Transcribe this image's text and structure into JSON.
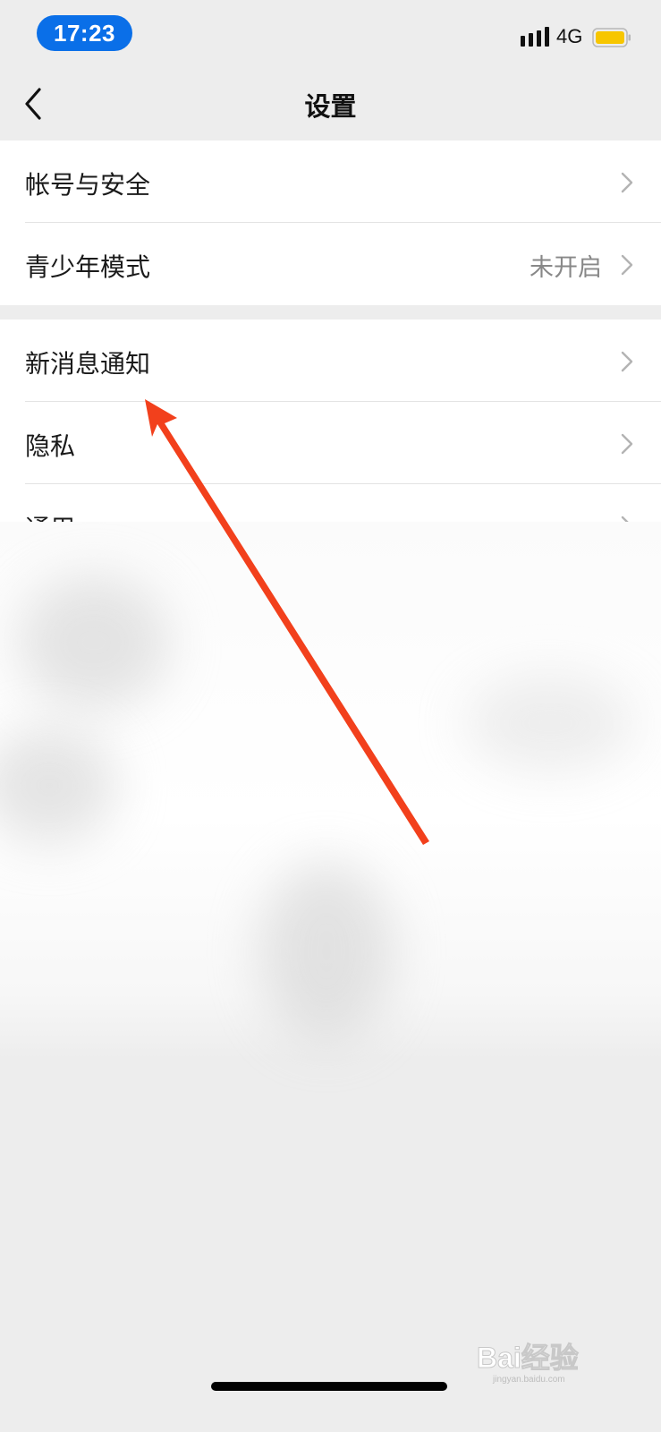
{
  "status_bar": {
    "time": "17:23",
    "network": "4G",
    "signal_icon": "cellular-signal-icon",
    "battery_icon": "battery-icon",
    "battery_color": "#f7c600"
  },
  "nav": {
    "title": "设置",
    "back_icon": "chevron-left-icon"
  },
  "groups": [
    {
      "items": [
        {
          "label": "帐号与安全",
          "value": ""
        },
        {
          "label": "青少年模式",
          "value": "未开启"
        }
      ]
    },
    {
      "items": [
        {
          "label": "新消息通知",
          "value": ""
        },
        {
          "label": "隐私",
          "value": ""
        },
        {
          "label": "通用",
          "value": ""
        }
      ]
    }
  ],
  "annotation": {
    "arrow_color": "#f2401c",
    "arrow_icon": "red-arrow-annotation"
  },
  "watermark": {
    "text": "Bai经验",
    "sub": "jingyan.baidu.com"
  },
  "colors": {
    "accent": "#0a6fe8",
    "background": "#ededed",
    "secondary_text": "#888888"
  }
}
